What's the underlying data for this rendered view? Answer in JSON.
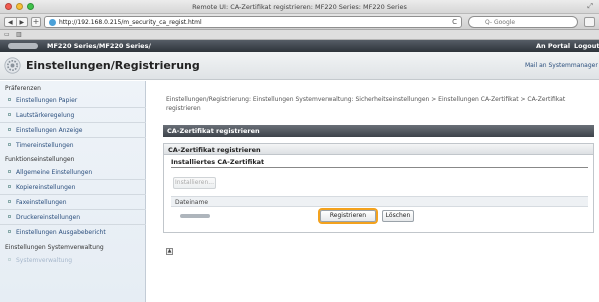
{
  "window": {
    "title": "Remote UI: CA-Zertifikat registrieren: MF220 Series: MF220 Series"
  },
  "browser": {
    "url": "http://192.168.0.215/m_security_ca_regist.html",
    "search_placeholder": "Q- Google",
    "bookmark_icons": [
      "grid-icon",
      "book-icon"
    ],
    "new_tab": "+",
    "back": "◀",
    "forward": "▶",
    "reload": "C"
  },
  "site_header": {
    "breadcrumb": "MF220 Series/MF220 Series/",
    "portal_link": "An Portal",
    "logout_link": "Logout"
  },
  "page_header": {
    "title": "Einstellungen/Registrierung",
    "mail_admin": "Mail an Systemmanager"
  },
  "sidebar": {
    "sections": [
      {
        "label": "Präferenzen",
        "items": [
          "Einstellungen Papier",
          "Lautstärkeregelung",
          "Einstellungen Anzeige",
          "Timereinstellungen"
        ]
      },
      {
        "label": "Funktionseinstellungen",
        "items": [
          "Allgemeine Einstellungen",
          "Kopiereinstellungen",
          "Faxeinstellungen",
          "Druckereinstellungen",
          "Einstellungen Ausgabebericht"
        ]
      },
      {
        "label": "Einstellungen Systemverwaltung",
        "items": [
          "Systemverwaltung"
        ]
      }
    ]
  },
  "main": {
    "path_text": "Einstellungen/Registrierung: Einstellungen Systemverwaltung: Sicherheitseinstellungen > Einstellungen CA-Zertifikat > CA-Zertifikat registrieren",
    "heading": "CA-Zertifikat registrieren",
    "panel_title": "CA-Zertifikat registrieren",
    "installed_heading": "Installiertes CA-Zertifikat",
    "install_button": "Installieren...",
    "column_filename": "Dateiname",
    "register_button": "Registrieren",
    "delete_button": "Löschen"
  },
  "colors": {
    "highlight": "#f3a21e",
    "header_dark": "#3d434a",
    "link": "#2a4e7d"
  }
}
